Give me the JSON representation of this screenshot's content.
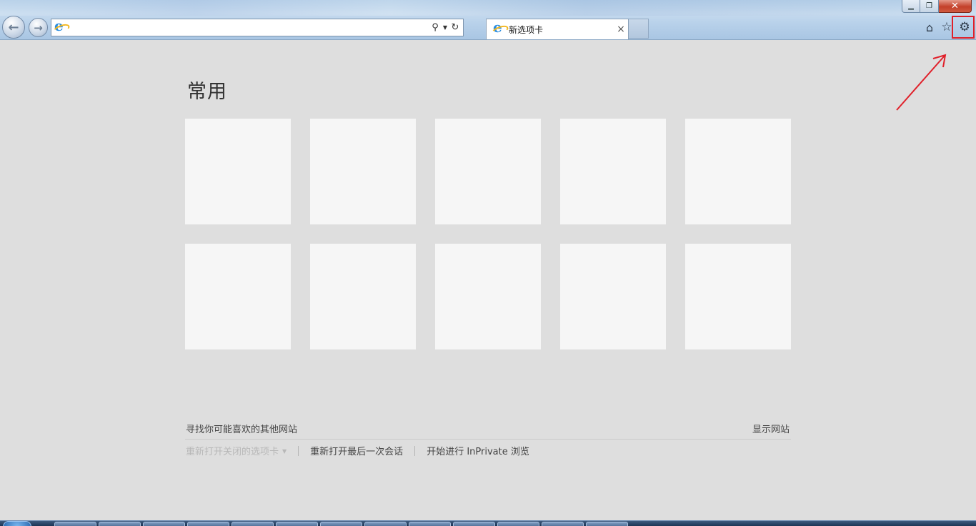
{
  "window": {
    "controls": {
      "minimize": "▁",
      "restore": "❐",
      "close": "✕"
    }
  },
  "nav": {
    "back_icon": "back-arrow-icon",
    "back_glyph": "←",
    "forward_icon": "forward-arrow-icon",
    "forward_glyph": "→"
  },
  "addressbar": {
    "value": "",
    "placeholder": "",
    "search_glyph": "⚲",
    "dropdown_glyph": "▼",
    "refresh_glyph": "↻"
  },
  "tab": {
    "label": "新选项卡",
    "close_glyph": "×"
  },
  "toolbar": {
    "home_glyph": "⌂",
    "favorites_glyph": "☆",
    "tools_glyph": "⚙"
  },
  "annotation": {
    "highlight_color": "#e0202a"
  },
  "newtab": {
    "title": "常用",
    "tiles_count": 10,
    "suggest_label": "寻找你可能喜欢的其他网站",
    "show_sites_label": "显示网站",
    "reopen_closed_label": "重新打开关闭的选项卡",
    "reopen_session_label": "重新打开最后一次会话",
    "inprivate_label": "开始进行 InPrivate 浏览"
  },
  "colors": {
    "page_bg": "#dedede",
    "tile_bg": "#f6f6f6",
    "titlebar": "#b8d1ea",
    "accent_red": "#e0202a"
  }
}
